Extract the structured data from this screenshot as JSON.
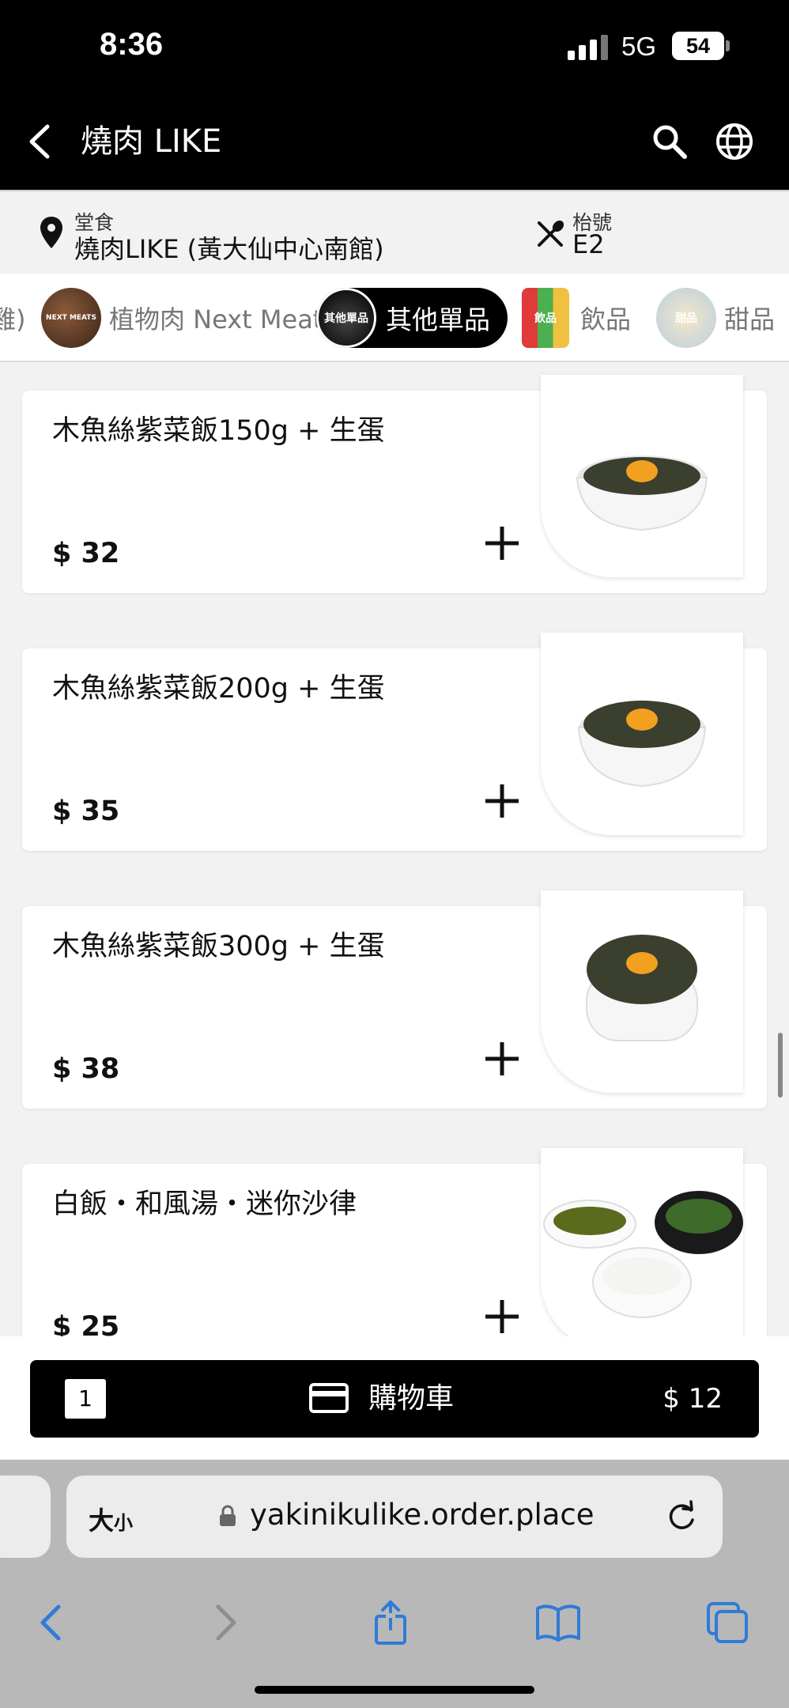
{
  "status": {
    "time": "8:36",
    "network": "5G",
    "battery": "54"
  },
  "header": {
    "title": "燒肉 LIKE"
  },
  "info": {
    "dine_label": "堂食",
    "store": "燒肉LIKE (黃大仙中心南館)",
    "table_label": "枱號",
    "table": "E2"
  },
  "tabs": [
    {
      "label": "雞)"
    },
    {
      "label": "植物肉 Next Meat",
      "thumb": "NEXT MEATS"
    },
    {
      "label": "其他單品",
      "thumb": "其他單品",
      "active": true
    },
    {
      "label": "飲品",
      "thumb": "飲品"
    },
    {
      "label": "甜品",
      "thumb": "甜品"
    }
  ],
  "items": [
    {
      "name": "木魚絲紫菜飯150g + 生蛋",
      "price": "$ 32"
    },
    {
      "name": "木魚絲紫菜飯200g + 生蛋",
      "price": "$ 35"
    },
    {
      "name": "木魚絲紫菜飯300g + 生蛋",
      "price": "$ 38"
    },
    {
      "name": "白飯・和風湯・迷你沙律",
      "price": "$ 25"
    }
  ],
  "cart": {
    "count": "1",
    "label": "購物車",
    "total": "$ 12"
  },
  "browser": {
    "text_size_big": "大",
    "text_size_small": "小",
    "url": "yakinikulike.order.place"
  },
  "colors": {
    "header_bg": "#000000",
    "accent": "#000000",
    "browser_blue": "#2f7bd8"
  }
}
